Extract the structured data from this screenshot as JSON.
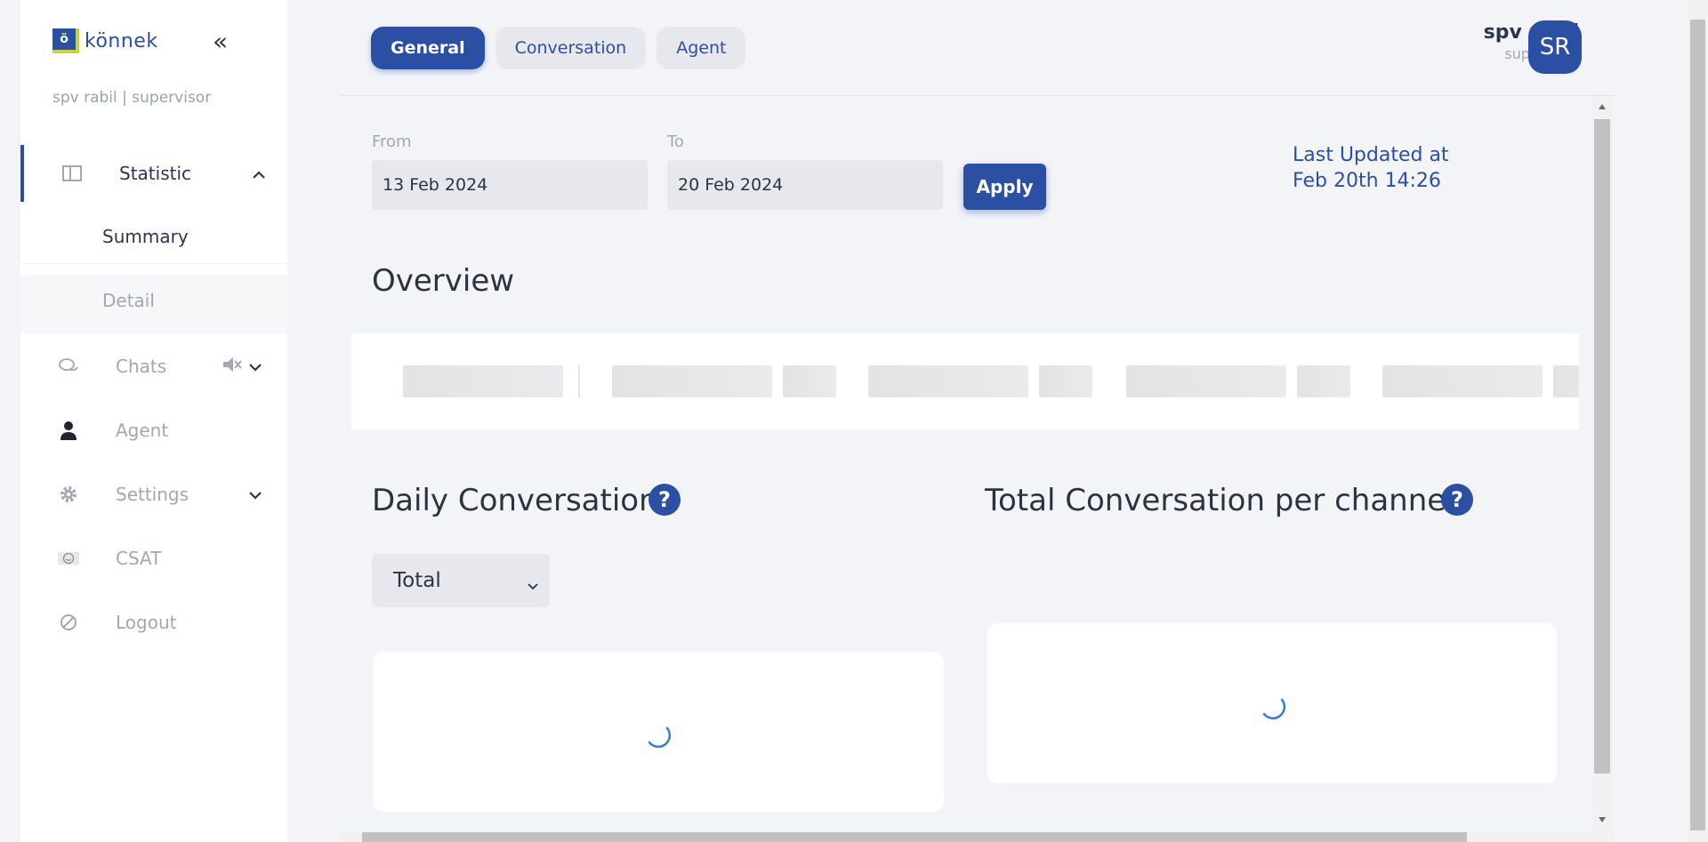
{
  "brand": {
    "logo_mark": "ö",
    "logo_text": "könnek"
  },
  "sidebar": {
    "user_line": "spv rabil | supervisor",
    "items": [
      {
        "label": "Statistic",
        "icon": "columns-icon"
      },
      {
        "label": "Chats",
        "icon": "chat-icon"
      },
      {
        "label": "Agent",
        "icon": "person-icon"
      },
      {
        "label": "Settings",
        "icon": "gear-icon"
      },
      {
        "label": "CSAT",
        "icon": "smiley-icon"
      },
      {
        "label": "Logout",
        "icon": "logout-icon"
      }
    ],
    "sub_items": [
      {
        "label": "Summary"
      },
      {
        "label": "Detail"
      }
    ]
  },
  "header": {
    "tabs": [
      {
        "label": "General"
      },
      {
        "label": "Conversation"
      },
      {
        "label": "Agent"
      }
    ],
    "profile": {
      "name": "spv rabil",
      "role": "supervisor",
      "initials": "SR"
    }
  },
  "filters": {
    "from_label": "From",
    "from_value": "13 Feb 2024",
    "to_label": "To",
    "to_value": "20 Feb 2024",
    "apply_label": "Apply"
  },
  "last_updated": {
    "line1": "Last Updated at",
    "line2": "Feb 20th 14:26"
  },
  "overview": {
    "title": "Overview"
  },
  "daily": {
    "title": "Daily Conversation",
    "help": "?",
    "select_value": "Total"
  },
  "per_channel": {
    "title": "Total Conversation per channel",
    "help": "?"
  },
  "colors": {
    "primary": "#2b4fa3",
    "accent": "#c6d33a",
    "muted": "#a3a8b0"
  }
}
